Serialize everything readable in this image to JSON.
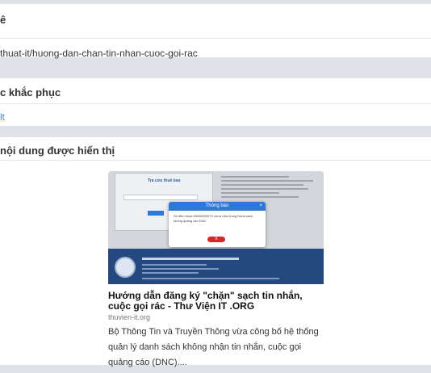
{
  "panel1": {
    "title": "ê",
    "value": "thuat-it/huong-dan-chan-tin-nhan-cuoc-goi-rac"
  },
  "panel2": {
    "title": "c khắc phục",
    "link": "lt"
  },
  "panel3": {
    "title": "nội dung được hiển thị",
    "card": {
      "dialog_title": "Thông báo",
      "dialog_close": "×",
      "dialog_body": "Số điện thoại 84938025972 chưa nằm trong Danh sách không quảng cáo DNC",
      "dialog_button": "X",
      "form_title": "Tra cứu thuê bao",
      "title": "Hướng dẫn đăng ký \"chặn\" sạch tin nhắn, cuộc gọi rác - Thư Viện IT .ORG",
      "domain": "thuvien-it.org",
      "description": "Bộ Thông Tin và Truyền Thông vừa công bố hệ thống quản lý danh sách không nhận tin nhắn, cuộc gọi quảng cáo (DNC)...."
    }
  },
  "colors": {
    "link": "#3b8fd6",
    "dialog_header": "#2c79d6",
    "thumb_footer": "#24487f",
    "button_red": "#d9262b"
  }
}
